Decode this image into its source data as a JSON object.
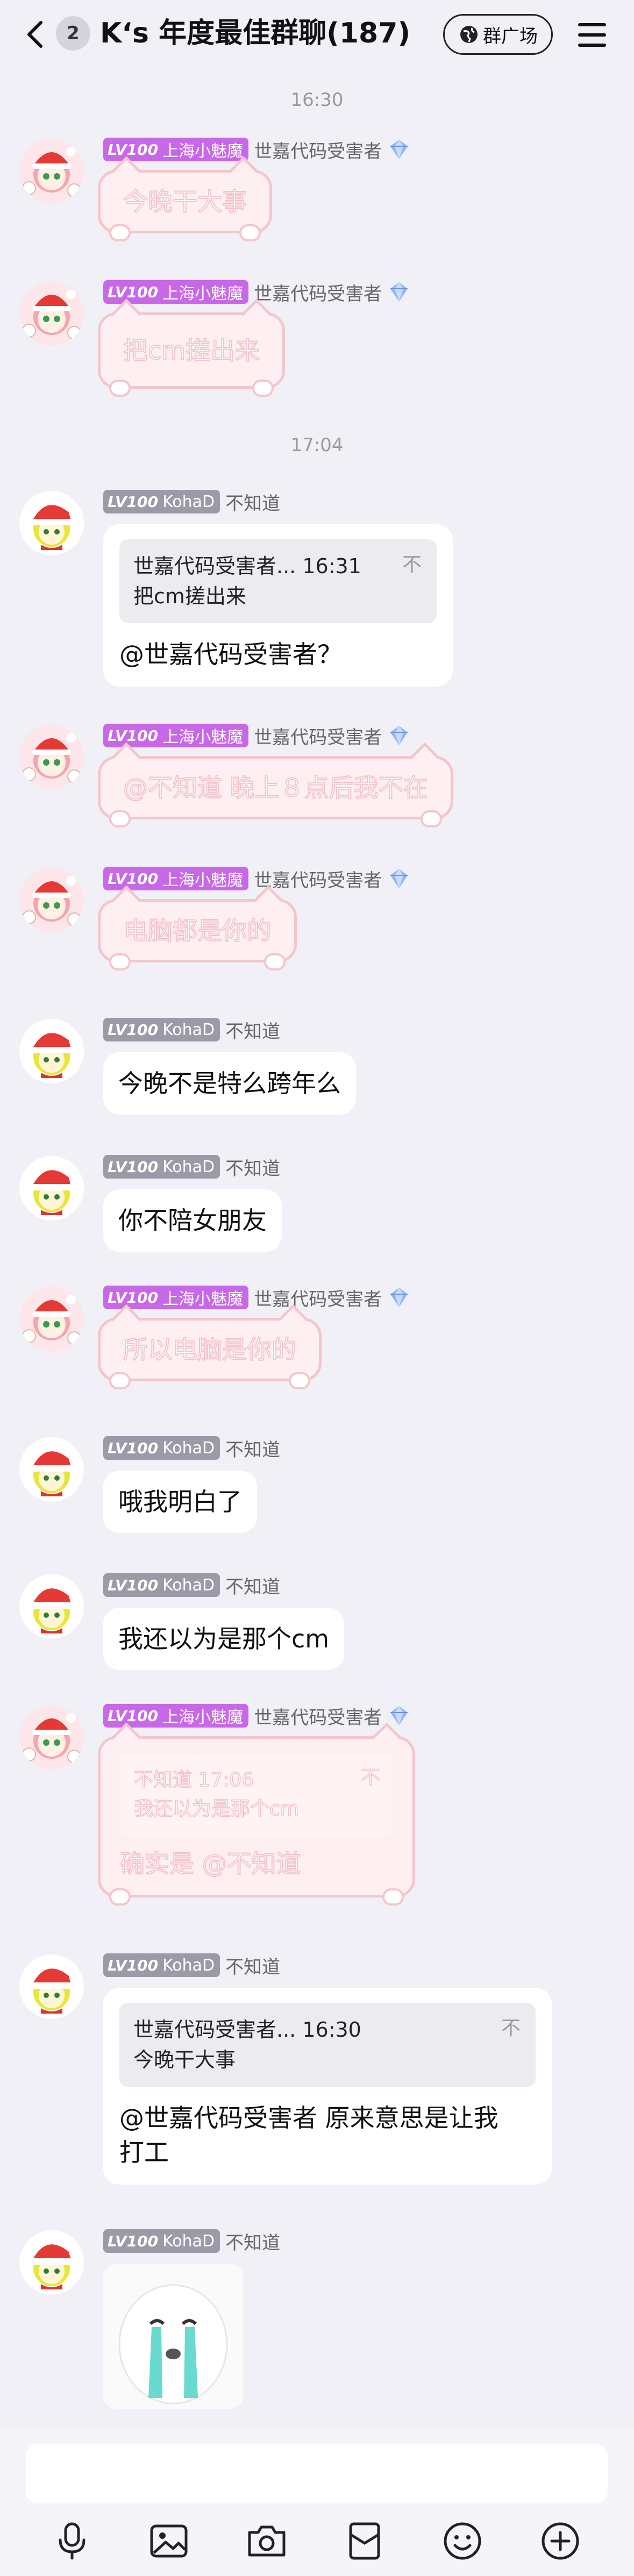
{
  "header": {
    "unread_count": "2",
    "title": "K‘s 年度最佳群聊(187)",
    "square_label": "群广场"
  },
  "time_separators": [
    "16:30",
    "17:04"
  ],
  "users": {
    "mo": {
      "level": "LV100",
      "title": "上海小魅魔",
      "nickname": "世嘉代码受害者"
    },
    "koha": {
      "level": "LV100",
      "title": "KohaD",
      "nickname": "不知道"
    }
  },
  "messages": [
    {
      "text": "今晚干大事"
    },
    {
      "text": "把cm搓出来"
    },
    {
      "quote_author": "世嘉代码受害者... 16:31",
      "quote_text": "把cm搓出来",
      "quote_mark": "不",
      "text": "@世嘉代码受害者？"
    },
    {
      "text": "@不知道 晚上８点后我不在"
    },
    {
      "text": "电脑都是你的"
    },
    {
      "text": "今晚不是特么跨年么"
    },
    {
      "text": "你不陪女朋友"
    },
    {
      "text": "所以电脑是你的"
    },
    {
      "text": "哦我明白了"
    },
    {
      "text": "我还以为是那个cm"
    },
    {
      "quote_author": "不知道 17:06",
      "quote_text": "我还以为是那个cm",
      "quote_mark": "不",
      "text": "确实是 @不知道"
    },
    {
      "quote_author": "世嘉代码受害者... 16:30",
      "quote_text": "今晚干大事",
      "quote_mark": "不",
      "text_line1": "@世嘉代码受害者 原来意思是让我",
      "text_line2": "打工"
    },
    {
      "sticker": "crying-face-sticker"
    }
  ],
  "toolbar_icons": [
    "microphone-icon",
    "image-icon",
    "camera-icon",
    "red-packet-icon",
    "emoji-icon",
    "plus-icon"
  ]
}
